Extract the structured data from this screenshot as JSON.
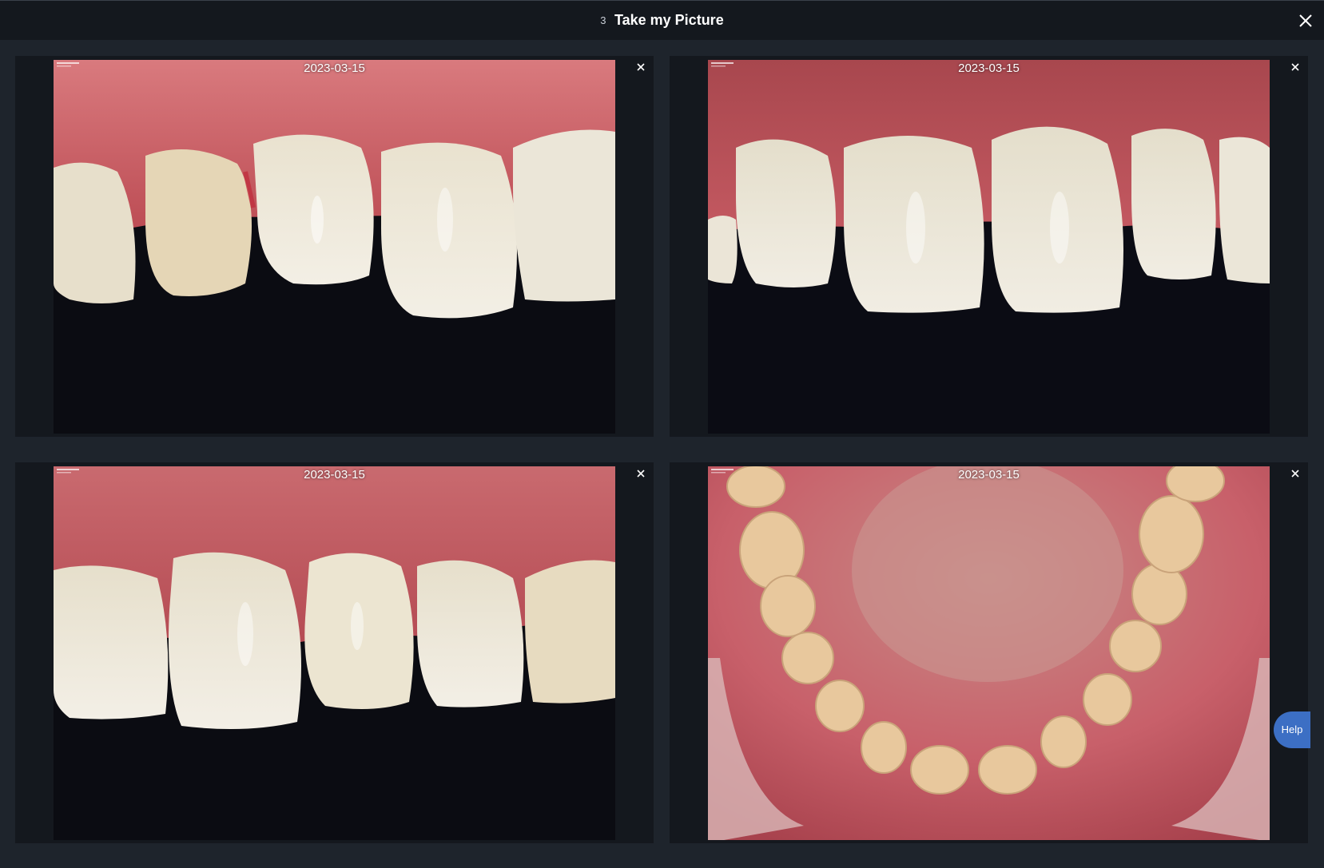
{
  "header": {
    "count": "3",
    "title": "Take my Picture",
    "close_icon": "close-icon"
  },
  "photos": [
    {
      "date": "2023-03-15",
      "subject": "upper-teeth-right-lateral",
      "close_icon": "close-icon"
    },
    {
      "date": "2023-03-15",
      "subject": "upper-teeth-frontal",
      "close_icon": "close-icon"
    },
    {
      "date": "2023-03-15",
      "subject": "upper-teeth-left-lateral",
      "close_icon": "close-icon"
    },
    {
      "date": "2023-03-15",
      "subject": "lower-arch-occlusal",
      "close_icon": "close-icon"
    }
  ],
  "help": {
    "label": "Help"
  },
  "colors": {
    "background": "#1e242c",
    "panel": "#14181e",
    "gum": "#c55b62",
    "tooth": "#e8e2d2",
    "help_button": "#3c6fc4"
  }
}
